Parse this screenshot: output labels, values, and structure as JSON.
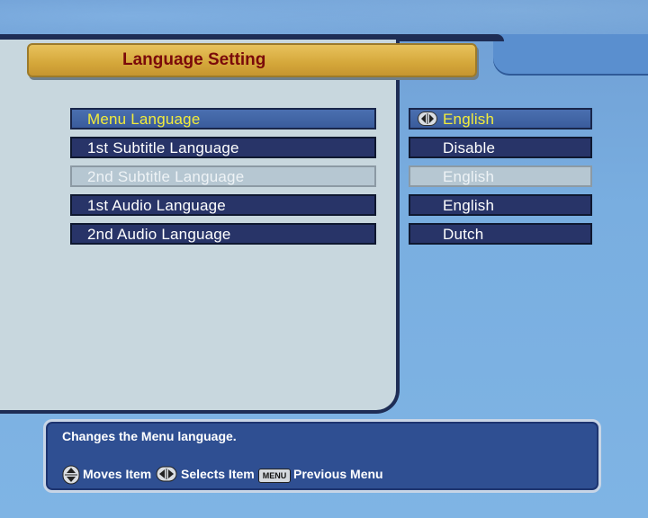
{
  "screen": {
    "title": "Language Setting"
  },
  "settings": [
    {
      "label": "Menu Language",
      "value": "English",
      "state": "selected"
    },
    {
      "label": "1st Subtitle Language",
      "value": "Disable",
      "state": "normal"
    },
    {
      "label": "2nd Subtitle Language",
      "value": "English",
      "state": "disabled"
    },
    {
      "label": "1st Audio Language",
      "value": "English",
      "state": "normal"
    },
    {
      "label": "2nd Audio Language",
      "value": "Dutch",
      "state": "normal"
    }
  ],
  "help": {
    "message": "Changes the Menu language.",
    "moves_label": "Moves Item",
    "selects_label": "Selects Item",
    "menu_key": "MENU",
    "menu_label": "Previous Menu"
  },
  "icons": {
    "up_down": "up-down-arrows-icon",
    "left_right": "left-right-arrows-icon",
    "menu_key": "menu-key-icon"
  },
  "colors": {
    "title_bar": "#d4a73a",
    "title_text": "#7a0a0a",
    "row_bg": "#283468",
    "selected_row": "#3a5c9c",
    "selected_text": "#f3ec3a",
    "disabled_row": "#b6c7d2",
    "panel_bg": "#c8d7de",
    "help_bg": "#2f4f92"
  }
}
